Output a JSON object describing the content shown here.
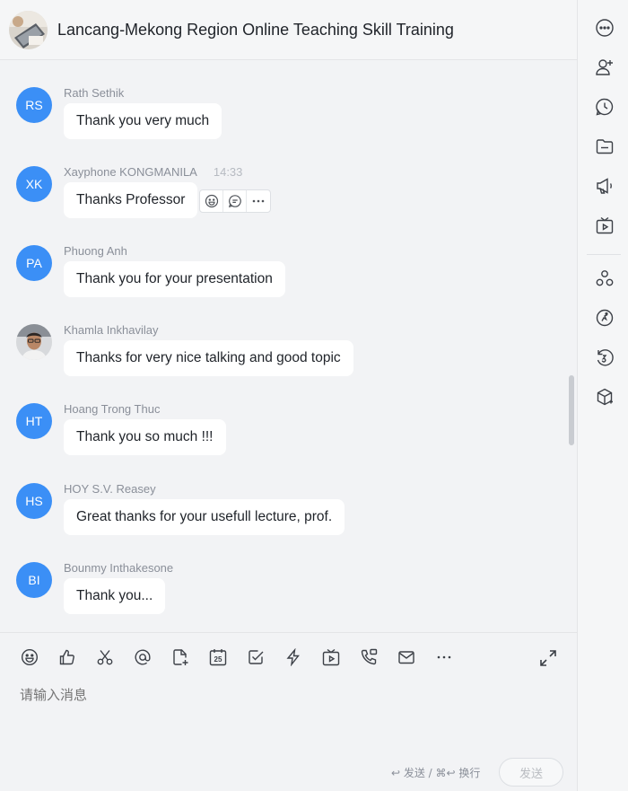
{
  "header": {
    "title": "Lancang-Mekong Region Online Teaching Skill Training"
  },
  "messages": [
    {
      "initials": "RS",
      "sender": "Rath Sethik",
      "time": "",
      "text": "Thank you very much"
    },
    {
      "initials": "XK",
      "sender": "Xayphone KONGMANILA",
      "time": "14:33",
      "text": "Thanks Professor"
    },
    {
      "initials": "PA",
      "sender": "Phuong Anh",
      "time": "",
      "text": "Thank you for your presentation"
    },
    {
      "initials": "",
      "sender": "Khamla Inkhavilay",
      "time": "",
      "text": "Thanks for very nice talking and good topic"
    },
    {
      "initials": "HT",
      "sender": "Hoang Trong Thuc",
      "time": "",
      "text": "Thank you so much !!!"
    },
    {
      "initials": "HS",
      "sender": "HOY S.V. Reasey",
      "time": "",
      "text": "Great thanks for your usefull lecture, prof."
    },
    {
      "initials": "BI",
      "sender": "Bounmy Inthakesone",
      "time": "",
      "text": "Thank you..."
    }
  ],
  "message_tools": [
    "emoji-reaction-icon",
    "reply-icon",
    "more-icon"
  ],
  "sidebar_icons": [
    "more-icon",
    "add-member-icon",
    "history-icon",
    "folder-icon",
    "announcement-icon",
    "live-icon",
    "apps-icon",
    "activity-icon",
    "timer-icon",
    "plugin-icon"
  ],
  "composer": {
    "toolbar_icons": [
      "emoji-icon",
      "thumbs-up-icon",
      "scissors-icon",
      "mention-icon",
      "doc-icon",
      "calendar-icon",
      "task-icon",
      "quick-icon",
      "video-icon",
      "call-icon",
      "mail-icon",
      "more-icon"
    ],
    "calendar_day": "25",
    "placeholder": "请输入消息",
    "shortcut_hint": "↩ 发送 / ⌘↩ 换行",
    "send_label": "发送"
  },
  "colors": {
    "avatar": "#3b8ff6",
    "bubble": "#ffffff",
    "background": "#f2f3f5"
  }
}
